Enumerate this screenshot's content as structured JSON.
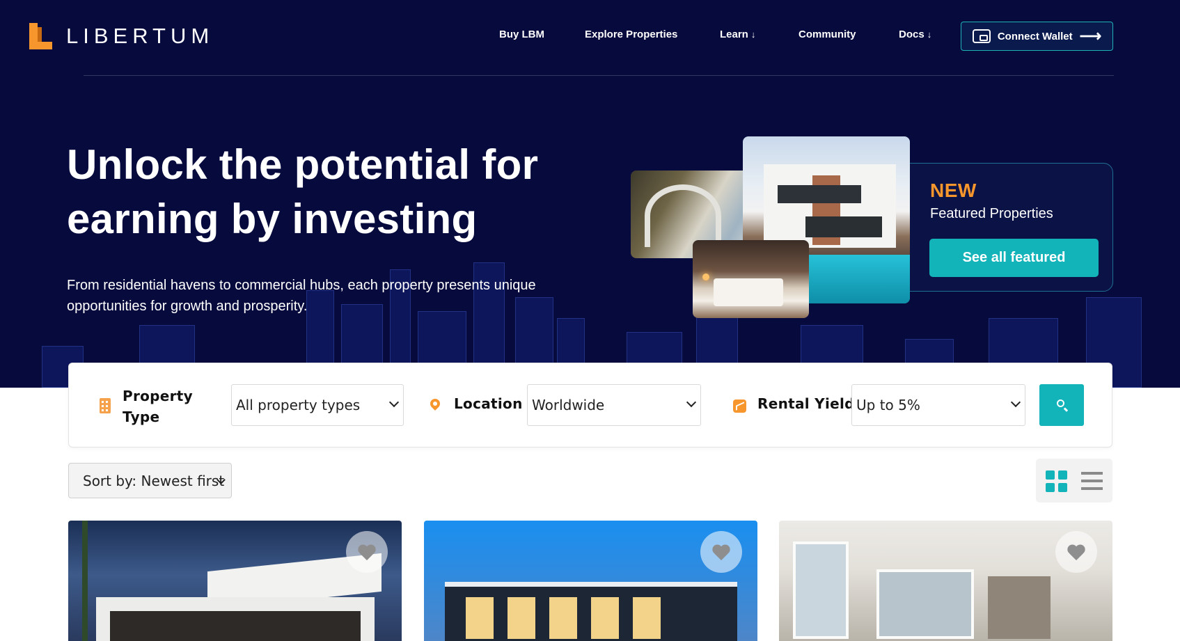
{
  "header": {
    "logo_text": "LIBERTUM",
    "nav": [
      {
        "label": "Buy LBM"
      },
      {
        "label": "Explore Properties"
      },
      {
        "label": "Learn",
        "arrow": "↓"
      },
      {
        "label": "Community"
      },
      {
        "label": "Docs",
        "arrow": "↓"
      }
    ],
    "connect_label": "Connect Wallet",
    "connect_arrow": "⟶"
  },
  "hero": {
    "title_line1": "Unlock the potential for",
    "title_line2": "earning by investing",
    "subtitle": "From residential havens to commercial hubs, each property presents unique opportunities for growth and prosperity."
  },
  "featured": {
    "badge": "NEW",
    "label": "Featured Properties",
    "button": "See all featured"
  },
  "search": {
    "property_type_label_1": "Property",
    "property_type_label_2": "Type",
    "property_type_value": "All property types",
    "location_label": "Location",
    "location_value": "Worldwide",
    "yield_label": "Rental Yield",
    "yield_value": "Up to 5%"
  },
  "listing": {
    "sort_value": "Sort by: Newest first",
    "view_mode": "grid"
  },
  "colors": {
    "hero_bg": "#070a3d",
    "accent_teal": "#12b3b9",
    "accent_orange": "#f7962c"
  },
  "icons": [
    "wallet-icon",
    "arrow-right-icon",
    "building-icon",
    "location-pin-icon",
    "trending-up-icon",
    "search-icon",
    "grid-view-icon",
    "list-view-icon",
    "heart-icon"
  ]
}
